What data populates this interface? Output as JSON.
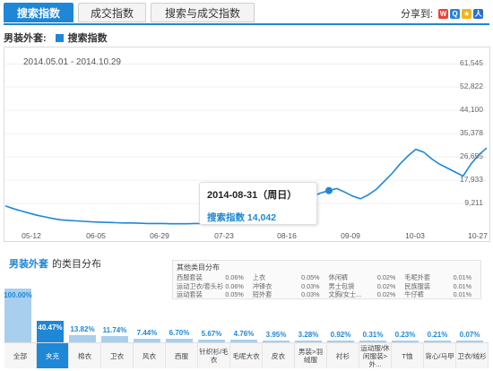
{
  "tabs": [
    {
      "label": "搜索指数",
      "active": true
    },
    {
      "label": "成交指数",
      "active": false
    },
    {
      "label": "搜索与成交指数",
      "active": false
    }
  ],
  "share": {
    "label": "分享到:",
    "icons": [
      "weibo-icon",
      "qzone-icon",
      "star-icon",
      "renren-icon"
    ]
  },
  "legend": {
    "title": "男装外套:",
    "series": "搜索指数"
  },
  "chart_data": {
    "type": "line",
    "date_range": "2014.05.01 - 2014.10.29",
    "x_tick_labels": [
      "05-12",
      "06-05",
      "06-29",
      "07-23",
      "08-16",
      "09-09",
      "10-03",
      "10-27"
    ],
    "y_tick_labels": [
      "9,211",
      "17,933",
      "26,655",
      "35,378",
      "44,100",
      "52,822",
      "61,545"
    ],
    "ylim": [
      500,
      62000
    ],
    "x": [
      "05-01",
      "05-04",
      "05-07",
      "05-10",
      "05-13",
      "05-16",
      "05-19",
      "05-22",
      "05-25",
      "05-28",
      "05-31",
      "06-03",
      "06-06",
      "06-09",
      "06-12",
      "06-15",
      "06-18",
      "06-21",
      "06-24",
      "06-27",
      "06-30",
      "07-03",
      "07-06",
      "07-09",
      "07-12",
      "07-15",
      "07-18",
      "07-21",
      "07-24",
      "07-27",
      "07-30",
      "08-02",
      "08-05",
      "08-08",
      "08-11",
      "08-14",
      "08-17",
      "08-20",
      "08-23",
      "08-26",
      "08-29",
      "08-31",
      "09-03",
      "09-06",
      "09-09",
      "09-12",
      "09-15",
      "09-18",
      "09-21",
      "09-24",
      "09-27",
      "09-30",
      "10-03",
      "10-06",
      "10-09",
      "10-12",
      "10-15",
      "10-18",
      "10-21",
      "10-24",
      "10-27",
      "10-29"
    ],
    "series": [
      {
        "name": "搜索指数",
        "values": [
          8300,
          7300,
          6400,
          5600,
          4800,
          4200,
          3600,
          3100,
          2900,
          2700,
          2500,
          2300,
          2200,
          2100,
          2000,
          1900,
          1900,
          1800,
          1700,
          1700,
          1700,
          1600,
          1600,
          1600,
          1700,
          1700,
          1800,
          1900,
          2000,
          2100,
          2200,
          2300,
          2400,
          2700,
          3200,
          4200,
          6500,
          9000,
          11500,
          12000,
          13200,
          14042,
          14800,
          13500,
          12000,
          11000,
          12500,
          14500,
          17500,
          20500,
          24000,
          27000,
          29500,
          28500,
          26000,
          24000,
          22500,
          21000,
          19500,
          24000,
          27500,
          30000
        ]
      }
    ],
    "highlight": {
      "date": "2014-08-31",
      "weekday": "周日",
      "label": "搜索指数",
      "value": "14,042"
    }
  },
  "tooltip": {
    "date": "2014-08-31",
    "weekday": "周日",
    "label": "搜索指数",
    "value": "14,042"
  },
  "section2": {
    "category": "男装外套",
    "suffix": "的类目分布"
  },
  "other_dist": {
    "title": "其他类目分布",
    "items": [
      {
        "name": "西服套装",
        "pct": "0.06%"
      },
      {
        "name": "上衣",
        "pct": "0.05%"
      },
      {
        "name": "休闲裤",
        "pct": "0.02%"
      },
      {
        "name": "毛呢外套",
        "pct": "0.01%"
      },
      {
        "name": "运动卫衣/套头衫",
        "pct": "0.06%"
      },
      {
        "name": "冲锋衣",
        "pct": "0.03%"
      },
      {
        "name": "男士包袋",
        "pct": "0.02%"
      },
      {
        "name": "民族服装",
        "pct": "0.01%"
      },
      {
        "name": "运动套装",
        "pct": "0.05%"
      },
      {
        "name": "短外套",
        "pct": "0.03%"
      },
      {
        "name": "文胸/女士...",
        "pct": "0.02%"
      },
      {
        "name": "牛仔裤",
        "pct": "0.01%"
      }
    ]
  },
  "distribution": [
    {
      "name": "全部",
      "pct": "100.00%",
      "value": 100,
      "selected": false
    },
    {
      "name": "夹克",
      "pct": "40.47%",
      "value": 40.47,
      "selected": true
    },
    {
      "name": "棉衣",
      "pct": "13.82%",
      "value": 13.82,
      "selected": false
    },
    {
      "name": "卫衣",
      "pct": "11.74%",
      "value": 11.74,
      "selected": false
    },
    {
      "name": "风衣",
      "pct": "7.44%",
      "value": 7.44,
      "selected": false
    },
    {
      "name": "西服",
      "pct": "6.70%",
      "value": 6.7,
      "selected": false
    },
    {
      "name": "针织衫/毛衣",
      "pct": "5.67%",
      "value": 5.67,
      "selected": false
    },
    {
      "name": "毛呢大衣",
      "pct": "4.76%",
      "value": 4.76,
      "selected": false
    },
    {
      "name": "皮衣",
      "pct": "3.95%",
      "value": 3.95,
      "selected": false
    },
    {
      "name": "男装>羽绒服",
      "pct": "3.28%",
      "value": 3.28,
      "selected": false
    },
    {
      "name": "衬衫",
      "pct": "0.92%",
      "value": 0.92,
      "selected": false
    },
    {
      "name": "运动服/休闲服装>外...",
      "pct": "0.31%",
      "value": 0.31,
      "selected": false
    },
    {
      "name": "T恤",
      "pct": "0.23%",
      "value": 0.23,
      "selected": false
    },
    {
      "name": "背心/马甲",
      "pct": "0.21%",
      "value": 0.21,
      "selected": false
    },
    {
      "name": "卫衣/绒衫",
      "pct": "0.07%",
      "value": 0.07,
      "selected": false
    }
  ],
  "colors": {
    "accent": "#1e87d6",
    "bar": "#a9cfee"
  }
}
